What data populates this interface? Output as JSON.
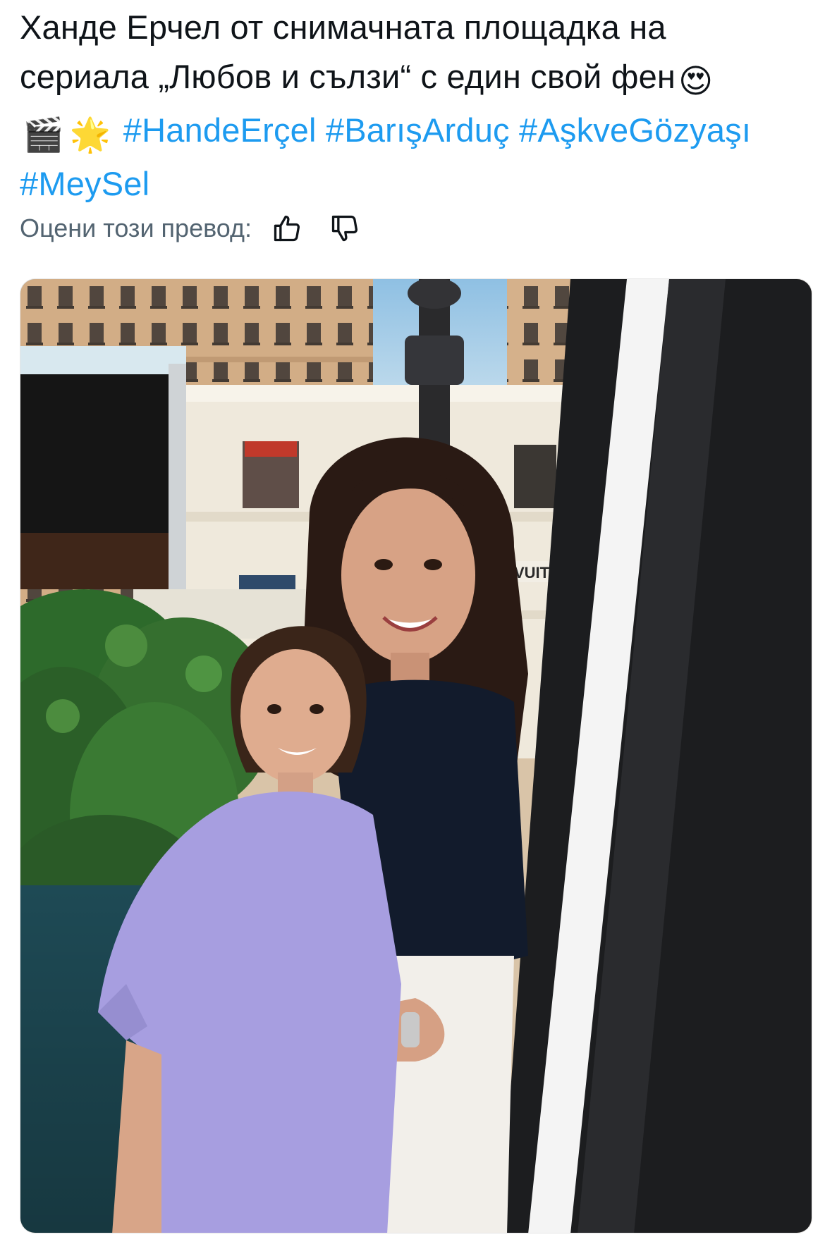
{
  "post": {
    "text_line1": "Ханде Ерчел от снимачната площадка на",
    "text_line2": "сериала „Любов и сълзи“ с един свой фен",
    "emoji_heart_eyes": "😍",
    "emoji_clapper": "🎬",
    "emoji_star": "🌟",
    "hashtags": [
      "#HandeErçel",
      "#BarışArduç",
      "#AşkveGözyaşı",
      "#MeySel"
    ]
  },
  "rating": {
    "label": "Оцени този превод:",
    "thumbs_up_icon": "thumbs-up-icon",
    "thumbs_down_icon": "thumbs-down-icon"
  },
  "photo": {
    "store_sign_text": "VUITTON",
    "colors": {
      "sky": "#a9cfe6",
      "building": "#d8b58f",
      "white_building": "#efe9dc",
      "tshirt": "#a79ee0",
      "dress": "#111a2b",
      "plants": "#2f6a2a",
      "frame": "#1c1d1f"
    }
  },
  "colors": {
    "text": "#0f1419",
    "hashtag": "#1d9bf0",
    "muted": "#536471"
  }
}
